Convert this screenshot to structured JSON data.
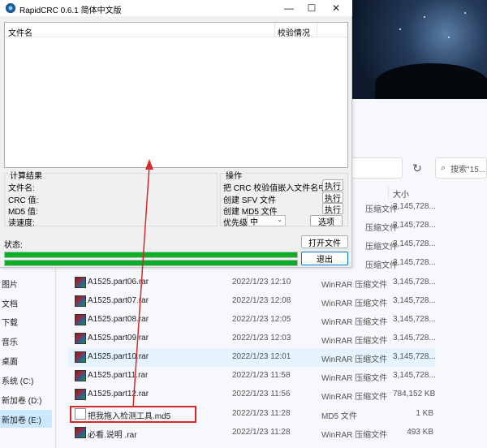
{
  "crc": {
    "title": "RapidCRC 0.6.1 简体中文版",
    "list": {
      "col_filename": "文件名",
      "col_status": "校验情况"
    },
    "results": {
      "title": "计算结果",
      "labels": [
        "文件名:",
        "CRC 值:",
        "MD5 值:",
        "读速度:"
      ]
    },
    "ops": {
      "title": "操作",
      "embed_crc": "把 CRC 校验值嵌入文件名中",
      "create_sfv": "创建 SFV 文件",
      "create_md5": "创建 MD5 文件",
      "priority_label": "优先级",
      "priority_value": "中",
      "execute": "执行",
      "options": "选项"
    },
    "status_label": "状态:",
    "open_file": "打开文件",
    "exit": "退出",
    "progress_1": 1.0,
    "progress_2": 1.0
  },
  "explorer": {
    "search_placeholder": "搜索\"15...",
    "size_header": "大小",
    "nav": [
      "图片",
      "文档",
      "下载",
      "音乐",
      "桌面",
      "系统 (C:)",
      "新加卷 (D:)",
      "新加卷 (E:)"
    ],
    "hidden_rows": [
      {
        "type": "压缩文件",
        "size": "3,145,728..."
      },
      {
        "type": "压缩文件",
        "size": "3,145,728..."
      },
      {
        "type": "压缩文件",
        "size": "3,145,728..."
      },
      {
        "type": "压缩文件",
        "size": "3,145,728..."
      }
    ],
    "files": [
      {
        "name": "A1525.part06.rar",
        "date": "2022/1/23 12:10",
        "type": "WinRAR 压缩文件",
        "size": "3,145,728..."
      },
      {
        "name": "A1525.part07.rar",
        "date": "2022/1/23 12:08",
        "type": "WinRAR 压缩文件",
        "size": "3,145,728..."
      },
      {
        "name": "A1525.part08.rar",
        "date": "2022/1/23 12:05",
        "type": "WinRAR 压缩文件",
        "size": "3,145,728..."
      },
      {
        "name": "A1525.part09.rar",
        "date": "2022/1/23 12:03",
        "type": "WinRAR 压缩文件",
        "size": "3,145,728..."
      },
      {
        "name": "A1525.part10.rar",
        "date": "2022/1/23 12:01",
        "type": "WinRAR 压缩文件",
        "size": "3,145,728..."
      },
      {
        "name": "A1525.part11.rar",
        "date": "2022/1/23 11:58",
        "type": "WinRAR 压缩文件",
        "size": "3,145,728..."
      },
      {
        "name": "A1525.part12.rar",
        "date": "2022/1/23 11:56",
        "type": "WinRAR 压缩文件",
        "size": "784,152 KB"
      },
      {
        "name": "把我拖入检测工具.md5",
        "date": "2022/1/23 11:28",
        "type": "MD5 文件",
        "size": "1 KB"
      },
      {
        "name": "必看.说明 .rar",
        "date": "2022/1/23 11:28",
        "type": "WinRAR 压缩文件",
        "size": "493 KB"
      }
    ]
  }
}
